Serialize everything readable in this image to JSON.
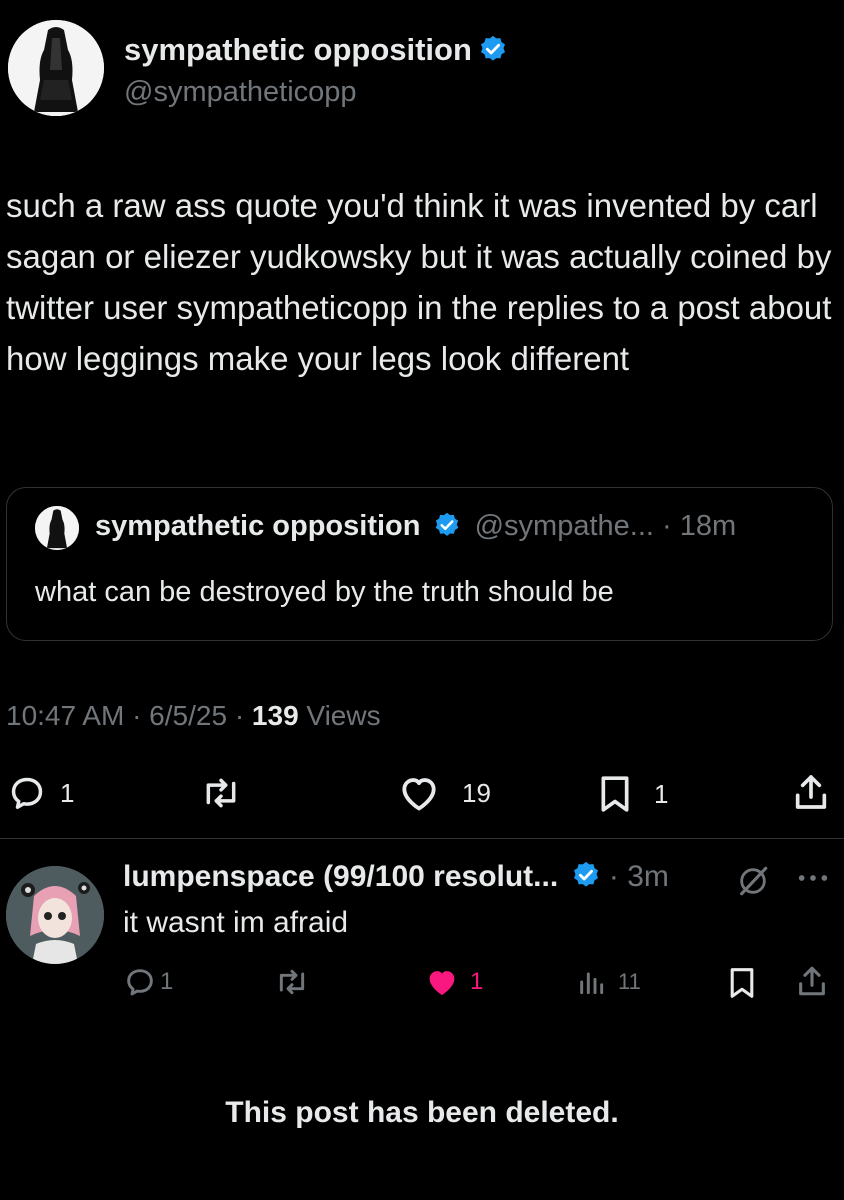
{
  "post": {
    "author_name": "sympathetic opposition",
    "author_handle": "@sympatheticopp",
    "text": "such a raw ass quote you'd think it was invented by carl sagan or eliezer yudkowsky but it was actually coined by twitter user sympatheticopp in the replies to a post about how leggings make your legs look different",
    "quote": {
      "author_name": "sympathetic opposition",
      "meta": "@sympathe... · 18m",
      "text": "what can be destroyed by the truth should be"
    },
    "time_date": "10:47 AM · 6/5/25 · ",
    "views_count": "139",
    "views_label": " Views",
    "actions": {
      "replies": "1",
      "likes": "19",
      "bookmarks": "1"
    }
  },
  "reply": {
    "author_name": "lumpenspace (99/100 resolut...",
    "meta": " · 3m",
    "text": "it wasnt im afraid",
    "actions": {
      "replies": "1",
      "likes": "1",
      "views": "11"
    }
  },
  "deleted_notice": "This post has been deleted.",
  "colors": {
    "background": "#000000",
    "text": "#e7e9ea",
    "muted": "#71767b",
    "verified": "#1d9bf0",
    "like_active": "#f91880"
  }
}
